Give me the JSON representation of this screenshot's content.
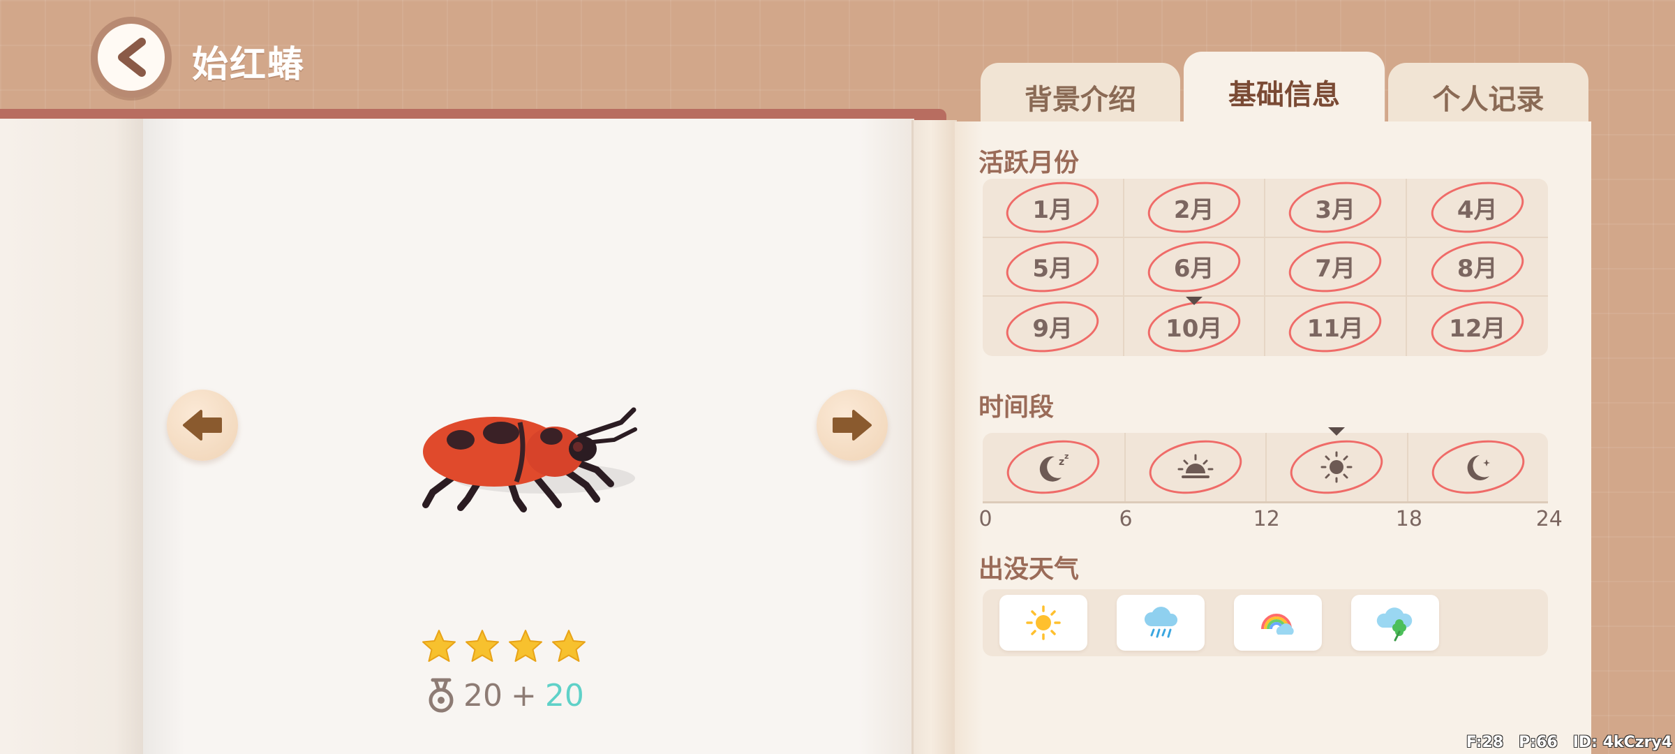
{
  "header": {
    "title": "始红蝽",
    "back_icon": "back-arrow-icon"
  },
  "tabs": [
    {
      "label": "背景介绍",
      "active": false
    },
    {
      "label": "基础信息",
      "active": true
    },
    {
      "label": "个人记录",
      "active": false
    }
  ],
  "creature": {
    "image": "red-beetle-insect",
    "stars": 4,
    "reward": {
      "base": "20",
      "plus": "+",
      "bonus": "20"
    },
    "reward_icon": "medal-icon"
  },
  "navigation": {
    "prev_icon": "arrow-left-icon",
    "next_icon": "arrow-right-icon"
  },
  "info": {
    "months_title": "活跃月份",
    "months": [
      "1月",
      "2月",
      "3月",
      "4月",
      "5月",
      "6月",
      "7月",
      "8月",
      "9月",
      "10月",
      "11月",
      "12月"
    ],
    "active_months": [
      1,
      2,
      3,
      4,
      5,
      6,
      7,
      8,
      9,
      10,
      11,
      12
    ],
    "current_month": "10月",
    "time_title": "时间段",
    "time_slots": [
      {
        "icon": "moon-zzz-icon",
        "active": true
      },
      {
        "icon": "sunrise-icon",
        "active": true
      },
      {
        "icon": "sun-icon",
        "active": true,
        "current": true
      },
      {
        "icon": "moon-icon",
        "active": true
      }
    ],
    "time_ticks": [
      "0",
      "6",
      "12",
      "18",
      "24"
    ],
    "weather_title": "出没天气",
    "weather": [
      "sunny-icon",
      "rain-icon",
      "rainbow-icon",
      "clover-cloud-icon"
    ]
  },
  "colors": {
    "background": "#d2a78a",
    "active_ring": "#ef6b68",
    "bonus": "#5fd1c8",
    "star": "#f7c12e"
  },
  "hud": {
    "f": "F:28",
    "p": "P:66",
    "id": "ID: 4kCzry4"
  }
}
